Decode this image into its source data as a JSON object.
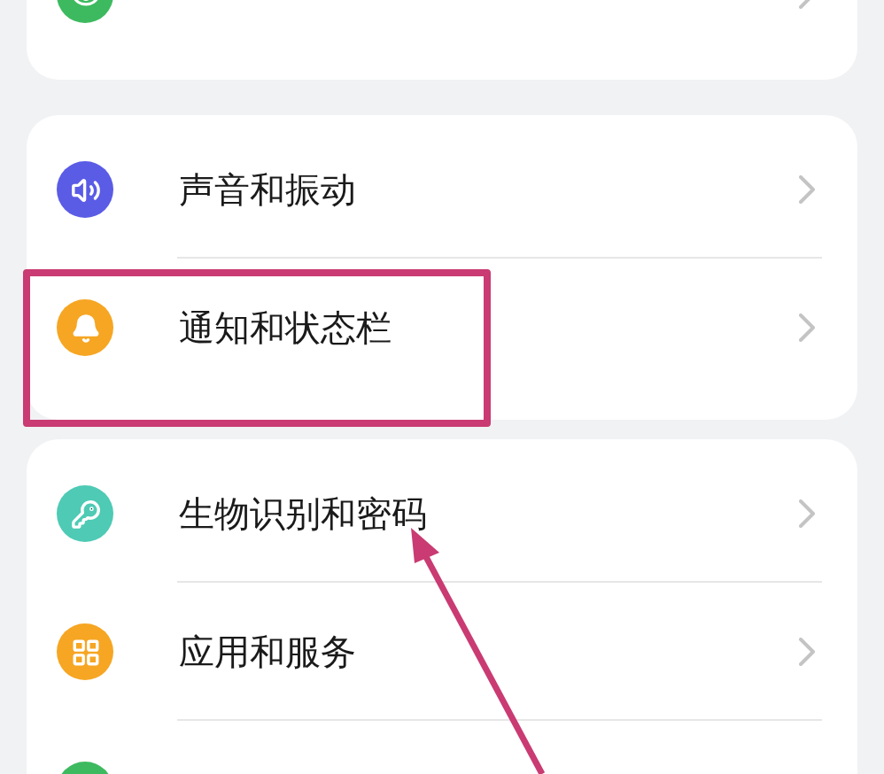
{
  "cards": [
    {
      "rows": [
        {
          "kind": "display",
          "color": "#3dba5f"
        }
      ]
    },
    {
      "rows": [
        {
          "kind": "sound",
          "color": "#5a5ce6",
          "label": "声音和振动"
        },
        {
          "kind": "notification",
          "color": "#f6a623",
          "label": "通知和状态栏"
        }
      ]
    },
    {
      "rows": [
        {
          "kind": "security",
          "color": "#4ecab5",
          "label": "生物识别和密码"
        },
        {
          "kind": "apps",
          "color": "#f6a623",
          "label": "应用和服务"
        },
        {
          "kind": "other",
          "color": "#3dba5f"
        }
      ]
    }
  ],
  "annotations": [
    {
      "kind": "box"
    },
    {
      "kind": "arrow"
    }
  ]
}
